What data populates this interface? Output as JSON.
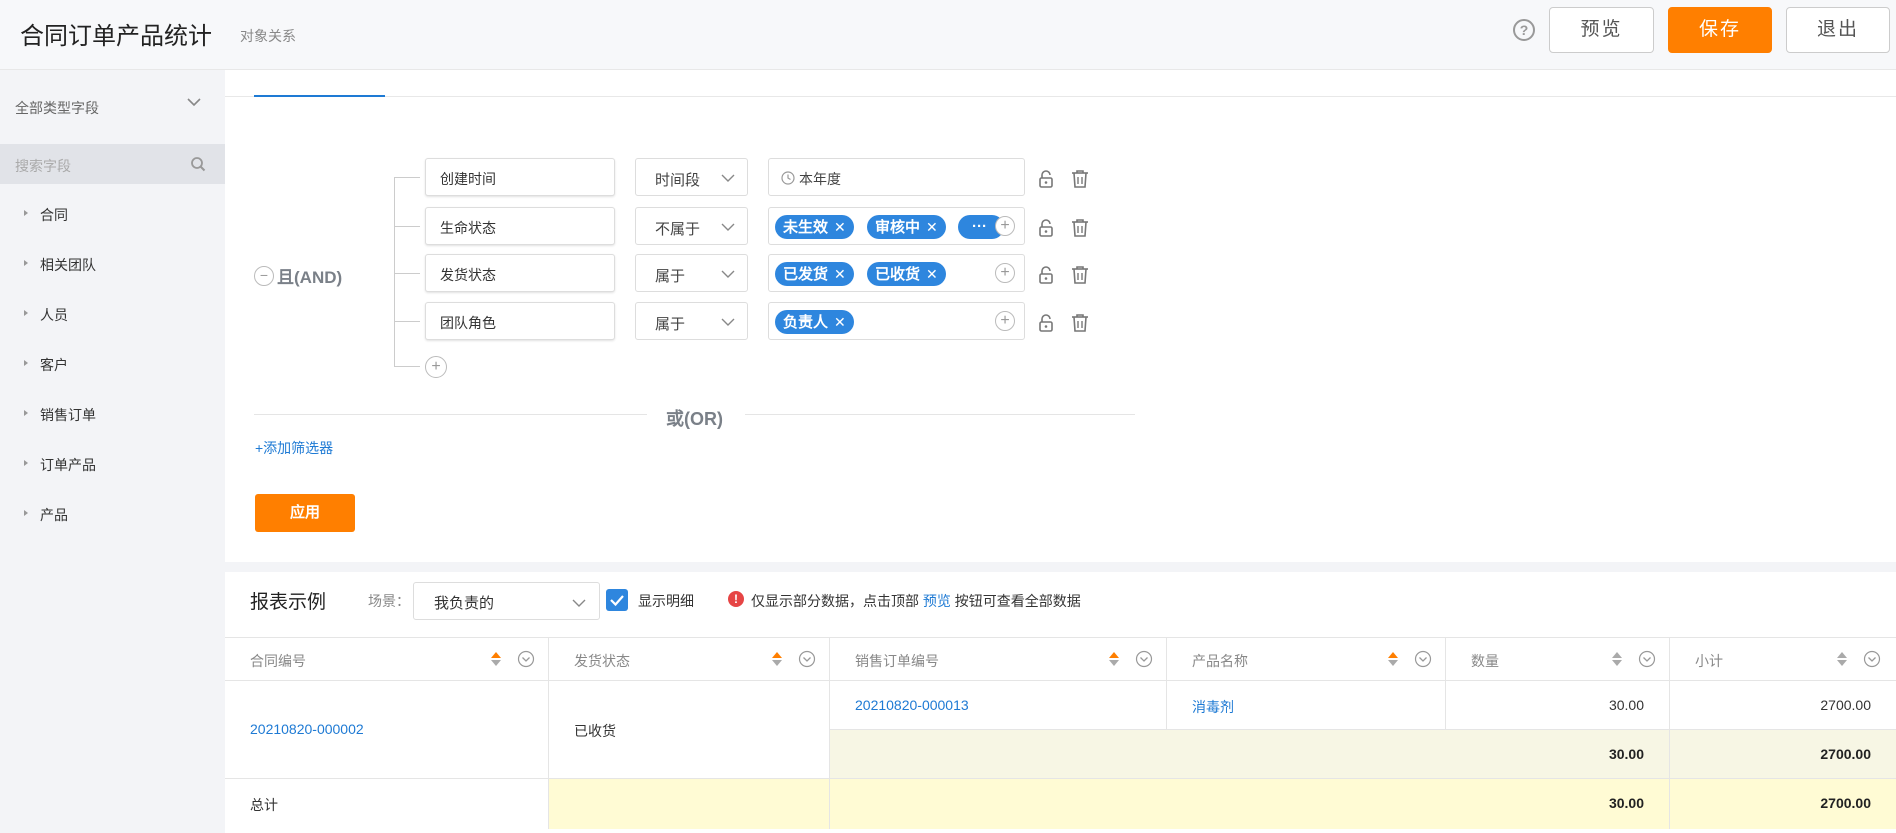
{
  "header": {
    "title": "合同订单产品统计",
    "subtitle": "对象关系",
    "help": "?",
    "preview_label": "预览",
    "save_label": "保存",
    "exit_label": "退出"
  },
  "sidebar": {
    "field_type": "全部类型字段",
    "search_placeholder": "搜索字段",
    "items": [
      {
        "label": "合同"
      },
      {
        "label": "相关团队"
      },
      {
        "label": "人员"
      },
      {
        "label": "客户"
      },
      {
        "label": "销售订单"
      },
      {
        "label": "订单产品"
      },
      {
        "label": "产品"
      }
    ]
  },
  "filter": {
    "and_label": "且(AND)",
    "or_label": "或(OR)",
    "add_filter": "+添加筛选器",
    "apply_label": "应用",
    "rows": [
      {
        "field": "创建时间",
        "operator": "时间段",
        "value": "本年度",
        "tags": []
      },
      {
        "field": "生命状态",
        "operator": "不属于",
        "tags": [
          "未生效",
          "审核中",
          "···"
        ]
      },
      {
        "field": "发货状态",
        "operator": "属于",
        "tags": [
          "已发货",
          "已收货"
        ]
      },
      {
        "field": "团队角色",
        "operator": "属于",
        "tags": [
          "负责人"
        ]
      }
    ]
  },
  "report": {
    "title": "报表示例",
    "scene_label": "场景：",
    "scene_value": "我负责的",
    "show_detail": "显示明细",
    "warn_before": "仅显示部分数据，点击顶部",
    "warn_link": "预览",
    "warn_after": "按钮可查看全部数据",
    "columns": [
      "合同编号",
      "发货状态",
      "销售订单编号",
      "产品名称",
      "数量",
      "小计"
    ],
    "rows": {
      "contract_no": "20210820-000002",
      "ship_status": "已收货",
      "order_no": "20210820-000013",
      "product": "消毒剂",
      "qty": "30.00",
      "subtotal": "2700.00",
      "group_qty": "30.00",
      "group_subtotal": "2700.00"
    },
    "total": {
      "label": "总计",
      "qty": "30.00",
      "subtotal": "2700.00"
    },
    "colors": {
      "accent": "#ff7f00",
      "link": "#1e7ad4",
      "tag": "#2e86de",
      "subtotal_bg": "#f7f6e4",
      "total_bg": "#fffbd4"
    }
  }
}
